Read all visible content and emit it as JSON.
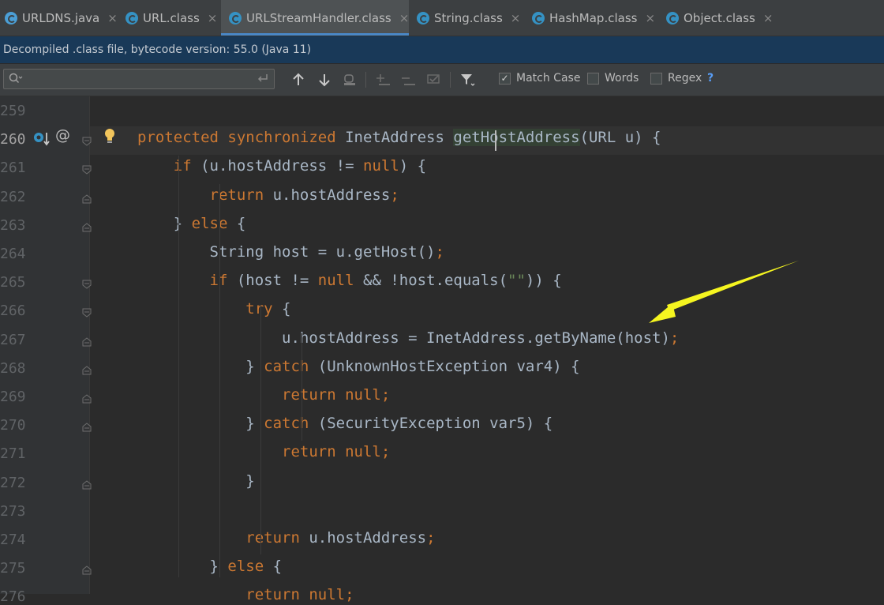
{
  "tabs": [
    {
      "label": "URLDNS.java",
      "icon": "java-class-icon"
    },
    {
      "label": "URL.class",
      "icon": "class-icon"
    },
    {
      "label": "URLStreamHandler.class",
      "icon": "class-icon",
      "active": true
    },
    {
      "label": "String.class",
      "icon": "class-icon"
    },
    {
      "label": "HashMap.class",
      "icon": "class-icon"
    },
    {
      "label": "Object.class",
      "icon": "class-icon"
    }
  ],
  "close_glyph": "×",
  "info_bar": "Decompiled .class file, bytecode version: 55.0 (Java 11)",
  "search": {
    "value": "",
    "placeholder": "",
    "match_case_label": "Match Case",
    "match_case_checked": true,
    "words_label": "Words",
    "words_checked": false,
    "regex_label": "Regex",
    "regex_checked": false,
    "help_label": "?"
  },
  "editor": {
    "current_line": "260",
    "lines": [
      {
        "num": "259",
        "tokens": []
      },
      {
        "num": "260",
        "tokens": [
          [
            "kw",
            "protected synchronized "
          ],
          [
            "pl",
            "InetAddress "
          ],
          [
            "hl",
            "getHostAddress"
          ],
          [
            "pl",
            "(URL u) {"
          ]
        ]
      },
      {
        "num": "261",
        "tokens": [
          [
            "pl",
            "    "
          ],
          [
            "kw",
            "if "
          ],
          [
            "pl",
            "(u.hostAddress != "
          ],
          [
            "kw",
            "null"
          ],
          [
            "pl",
            ") {"
          ]
        ]
      },
      {
        "num": "262",
        "tokens": [
          [
            "pl",
            "        "
          ],
          [
            "kw",
            "return "
          ],
          [
            "pl",
            "u.hostAddress"
          ],
          [
            "kw",
            ";"
          ]
        ]
      },
      {
        "num": "263",
        "tokens": [
          [
            "pl",
            "    } "
          ],
          [
            "kw",
            "else "
          ],
          [
            "pl",
            "{"
          ]
        ]
      },
      {
        "num": "264",
        "tokens": [
          [
            "pl",
            "        String host = u.getHost()"
          ],
          [
            "kw",
            ";"
          ]
        ]
      },
      {
        "num": "265",
        "tokens": [
          [
            "pl",
            "        "
          ],
          [
            "kw",
            "if "
          ],
          [
            "pl",
            "(host != "
          ],
          [
            "kw",
            "null "
          ],
          [
            "pl",
            "&& !host.equals("
          ],
          [
            "str",
            "\"\""
          ],
          [
            "pl",
            ")) {"
          ]
        ]
      },
      {
        "num": "266",
        "tokens": [
          [
            "pl",
            "            "
          ],
          [
            "kw",
            "try "
          ],
          [
            "pl",
            "{"
          ]
        ]
      },
      {
        "num": "267",
        "tokens": [
          [
            "pl",
            "                u.hostAddress = InetAddress.getByName(host)"
          ],
          [
            "kw",
            ";"
          ]
        ]
      },
      {
        "num": "268",
        "tokens": [
          [
            "pl",
            "            } "
          ],
          [
            "kw",
            "catch "
          ],
          [
            "pl",
            "(UnknownHostException var4) {"
          ]
        ]
      },
      {
        "num": "269",
        "tokens": [
          [
            "pl",
            "                "
          ],
          [
            "kw",
            "return null;"
          ]
        ]
      },
      {
        "num": "270",
        "tokens": [
          [
            "pl",
            "            } "
          ],
          [
            "kw",
            "catch "
          ],
          [
            "pl",
            "(SecurityException var5) {"
          ]
        ]
      },
      {
        "num": "271",
        "tokens": [
          [
            "pl",
            "                "
          ],
          [
            "kw",
            "return null;"
          ]
        ]
      },
      {
        "num": "272",
        "tokens": [
          [
            "pl",
            "            }"
          ]
        ]
      },
      {
        "num": "273",
        "tokens": []
      },
      {
        "num": "274",
        "tokens": [
          [
            "pl",
            "            "
          ],
          [
            "kw",
            "return "
          ],
          [
            "pl",
            "u.hostAddress"
          ],
          [
            "kw",
            ";"
          ]
        ]
      },
      {
        "num": "275",
        "tokens": [
          [
            "pl",
            "        } "
          ],
          [
            "kw",
            "else "
          ],
          [
            "pl",
            "{"
          ]
        ]
      },
      {
        "num": "276",
        "tokens": [
          [
            "pl",
            "            "
          ],
          [
            "kw",
            "return null;"
          ]
        ]
      }
    ]
  },
  "colors": {
    "keyword": "#cc7832",
    "plain": "#a9b7c6",
    "string": "#6a8759",
    "annotation_arrow": "#f5f520",
    "background": "#2b2b2b"
  }
}
